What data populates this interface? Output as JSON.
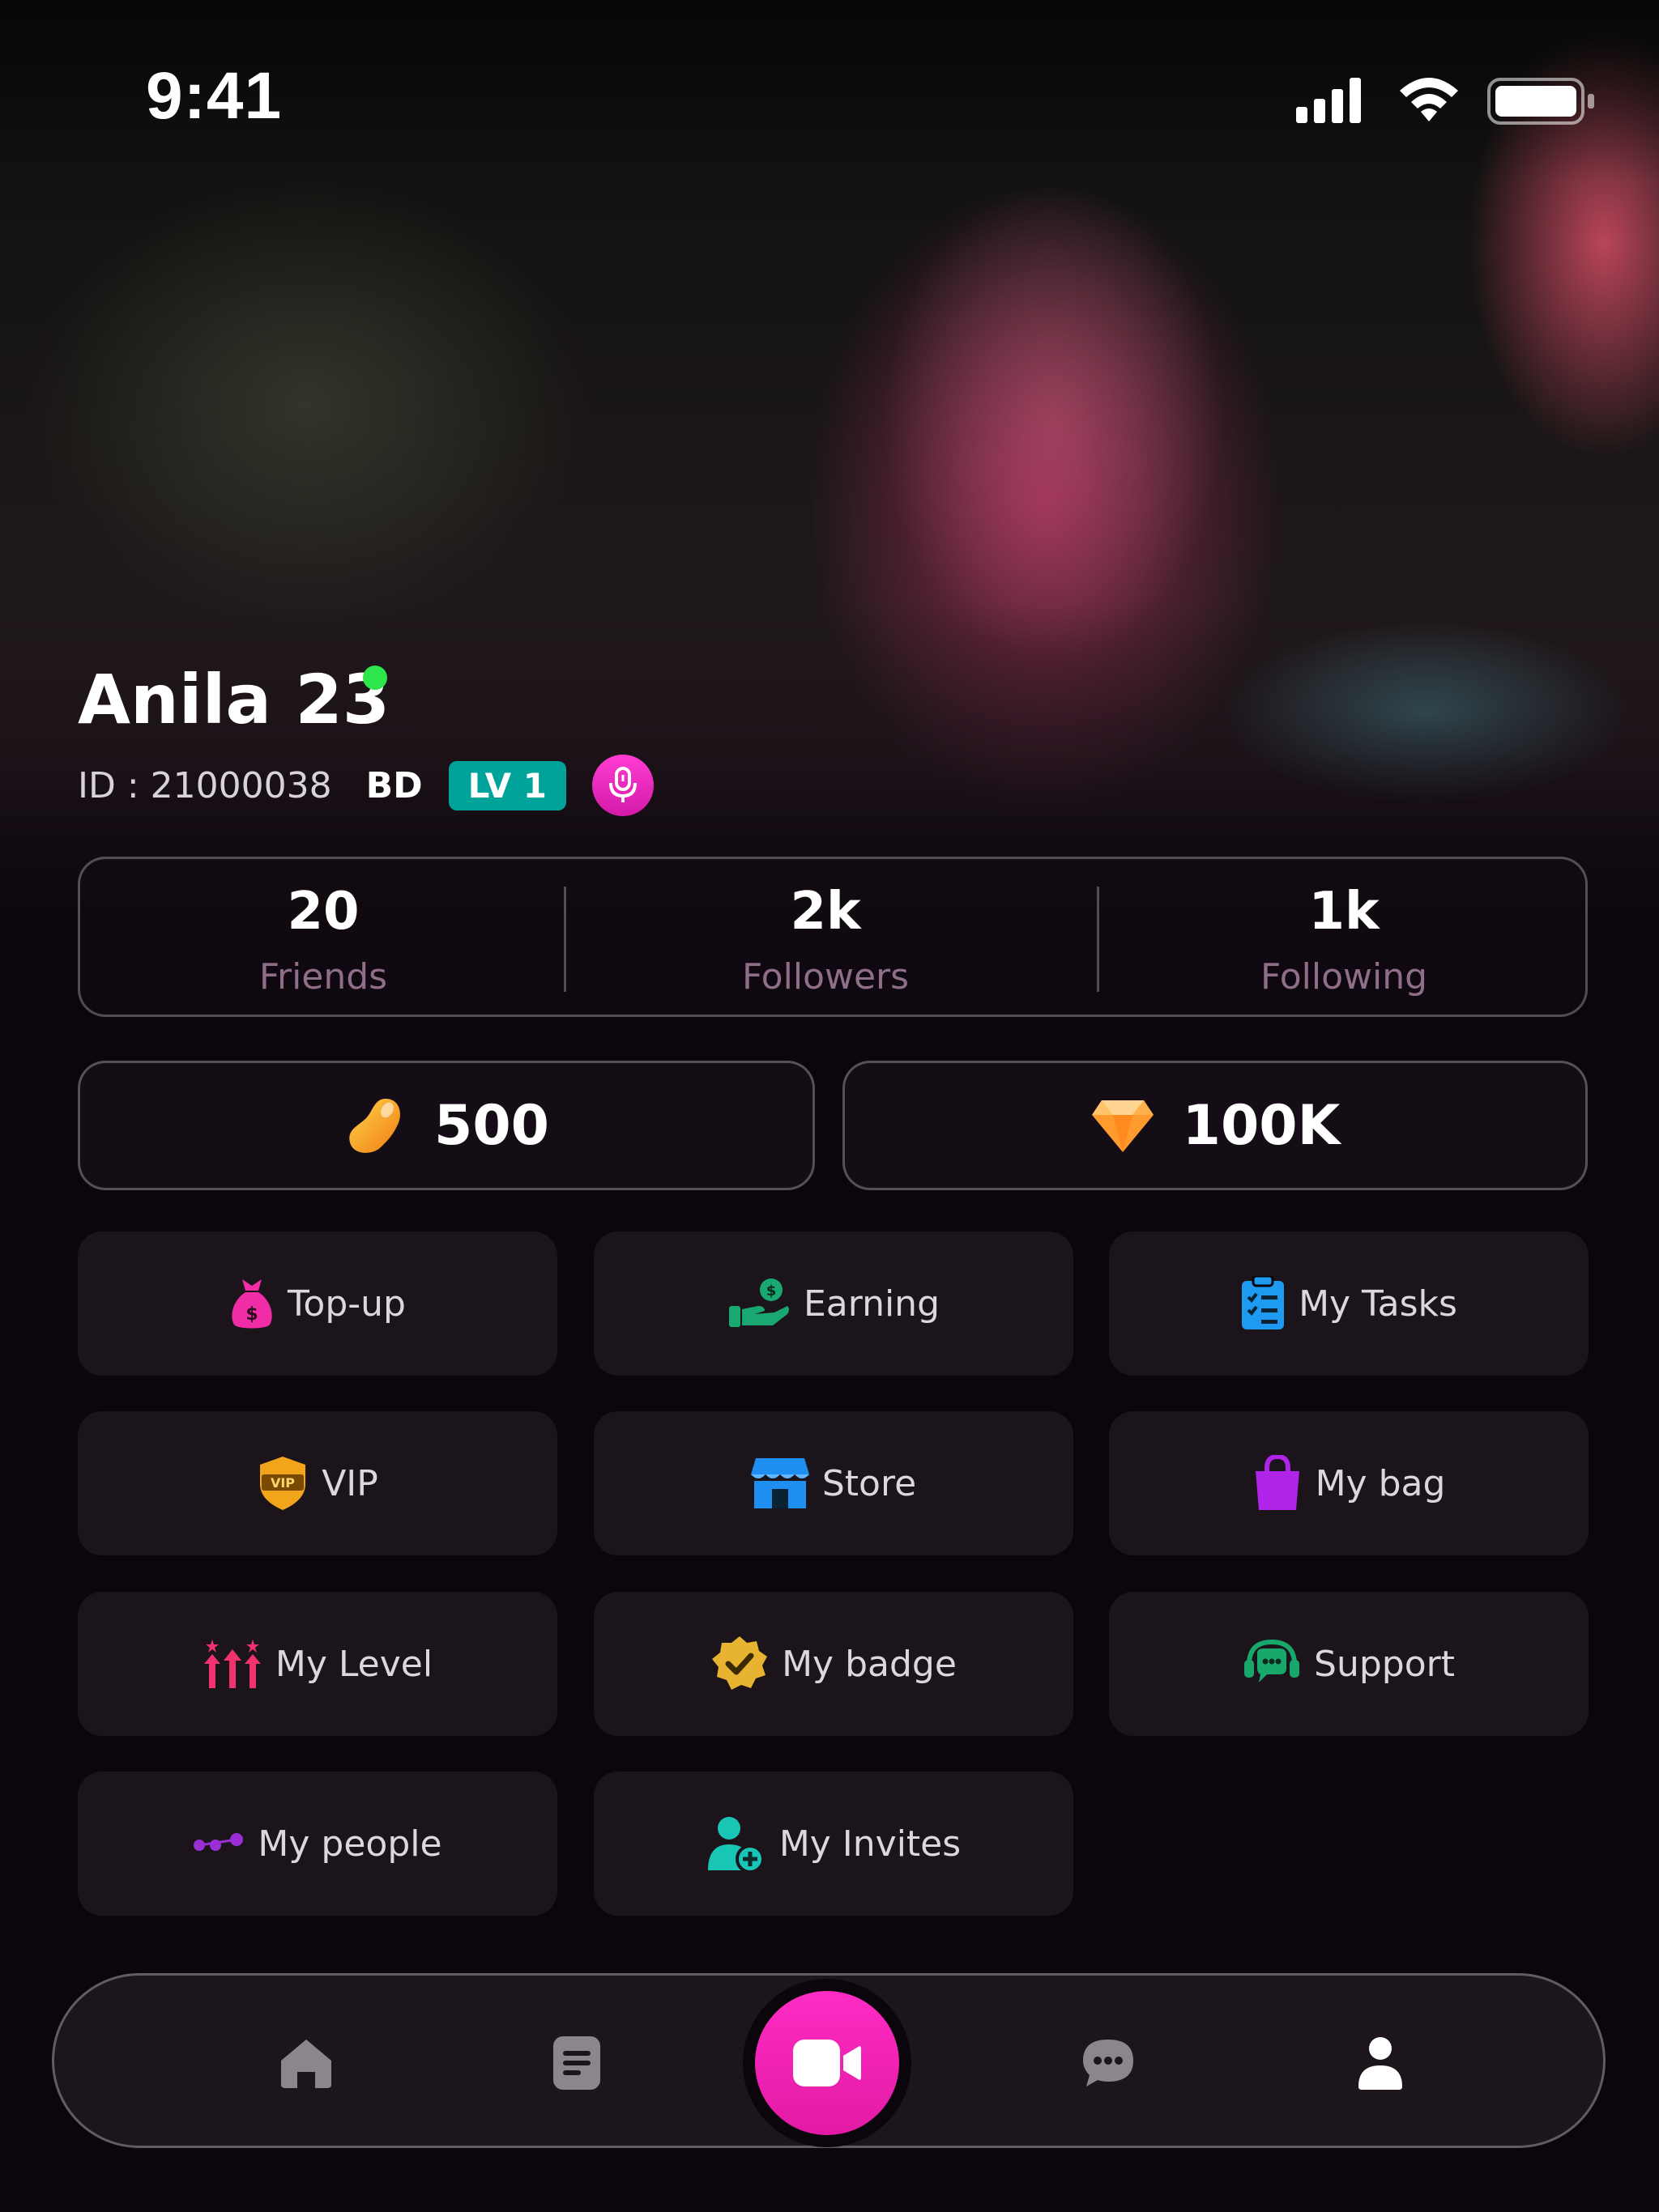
{
  "status_bar": {
    "time": "9:41"
  },
  "profile": {
    "name": "Anila 23",
    "id_text": "ID : 21000038",
    "country": "BD",
    "level": "LV 1"
  },
  "stats": [
    {
      "value": "20",
      "label": "Friends"
    },
    {
      "value": "2k",
      "label": "Followers"
    },
    {
      "value": "1k",
      "label": "Following"
    }
  ],
  "wallet": {
    "beans": "500",
    "diamonds": "100K"
  },
  "menu": [
    {
      "label": "Top-up",
      "icon": "money-bag-icon",
      "color": "#f02ca6"
    },
    {
      "label": "Earning",
      "icon": "hand-coin-icon",
      "color": "#1aa872"
    },
    {
      "label": "My Tasks",
      "icon": "clipboard-icon",
      "color": "#1e9bf0"
    },
    {
      "label": "VIP",
      "icon": "vip-shield-icon",
      "color": "#f2a51b"
    },
    {
      "label": "Store",
      "icon": "store-icon",
      "color": "#1e8ff0"
    },
    {
      "label": "My bag",
      "icon": "shopping-bag-icon",
      "color": "#b023e8"
    },
    {
      "label": "My Level",
      "icon": "level-arrows-icon",
      "color": "#f0336f"
    },
    {
      "label": "My badge",
      "icon": "badge-check-icon",
      "color": "#e8b330"
    },
    {
      "label": "Support",
      "icon": "headset-icon",
      "color": "#19a86c"
    },
    {
      "label": "My people",
      "icon": "people-dots-icon",
      "color": "#9a2fd6"
    },
    {
      "label": "My Invites",
      "icon": "add-user-icon",
      "color": "#19c6b5"
    }
  ],
  "nav": {
    "items": [
      "home-icon",
      "feed-icon",
      "video-camera-icon",
      "chat-icon",
      "profile-icon"
    ],
    "active": "profile-icon",
    "accent": "#ff2cc4"
  }
}
